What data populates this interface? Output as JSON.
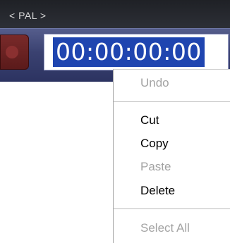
{
  "header": {
    "format_label": "< PAL >"
  },
  "timecode": {
    "value": "00:00:00:00"
  },
  "context_menu": {
    "items": [
      {
        "label": "Undo",
        "enabled": false
      },
      {
        "label": "Cut",
        "enabled": true
      },
      {
        "label": "Copy",
        "enabled": true
      },
      {
        "label": "Paste",
        "enabled": false
      },
      {
        "label": "Delete",
        "enabled": true
      },
      {
        "label": "Select All",
        "enabled": false
      }
    ]
  },
  "colors": {
    "selection_blue": "#1f45b0",
    "band_blue": "#3a4170",
    "disabled_text": "#a3a3a3"
  }
}
